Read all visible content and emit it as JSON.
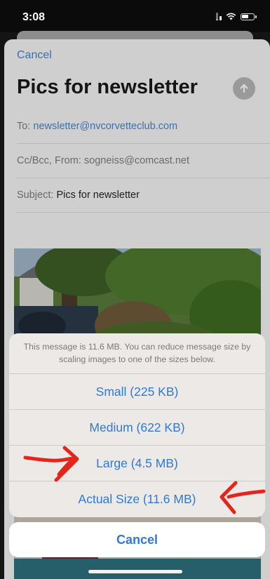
{
  "status_bar": {
    "time": "3:08",
    "icons": [
      "cellular-signal-icon",
      "wifi-icon",
      "battery-icon"
    ]
  },
  "compose": {
    "cancel_label": "Cancel",
    "title": "Pics for newsletter",
    "send_icon": "arrow-up-icon",
    "to_label": "To:",
    "to_value": "newsletter@nvcorvetteclub.com",
    "cc_label": "Cc/Bcc, From:",
    "from_value": "sogneiss@comcast.net",
    "subject_label": "Subject:",
    "subject_value": "Pics for newsletter"
  },
  "action_sheet": {
    "message": "This message is 11.6 MB. You can reduce message size by scaling images to one of the sizes below.",
    "options": [
      {
        "label": "Small (225 KB)"
      },
      {
        "label": "Medium (622 KB)"
      },
      {
        "label": "Large (4.5 MB)"
      },
      {
        "label": "Actual Size (11.6 MB)"
      }
    ],
    "cancel_label": "Cancel"
  },
  "colors": {
    "accent_blue": "#2f7ad6",
    "annotation_red": "#e3261c",
    "sheet_dimmed": "#cfcfcf",
    "action_sheet_bg": "#ece9e6"
  }
}
